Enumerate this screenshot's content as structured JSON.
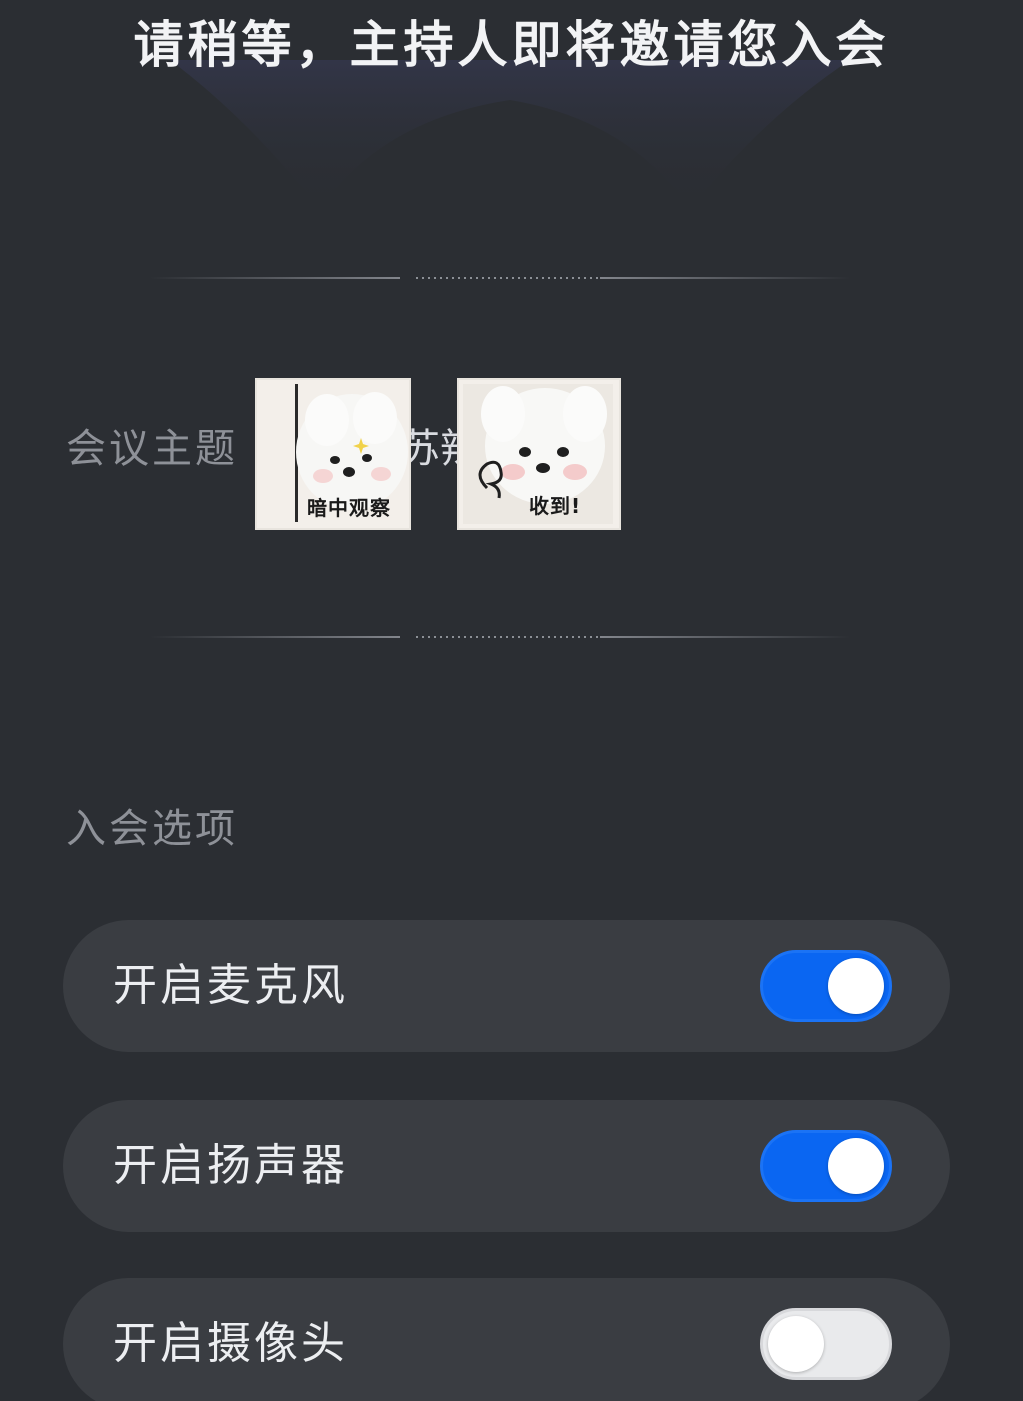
{
  "header": {
    "title": "请稍等，主持人即将邀请您入会"
  },
  "meeting": {
    "topic_label": "会议主题",
    "topic_value_partial": "苏辣"
  },
  "stickers": [
    {
      "icon": "dog-sticker-observing",
      "caption": "暗中观察"
    },
    {
      "icon": "dog-sticker-received",
      "caption": "收到!"
    }
  ],
  "options": {
    "section_label": "入会选项",
    "items": [
      {
        "label": "开启麦克风",
        "enabled": true
      },
      {
        "label": "开启扬声器",
        "enabled": true
      },
      {
        "label": "开启摄像头",
        "enabled": false
      }
    ]
  },
  "colors": {
    "background": "#2b2e33",
    "row_background": "#3a3d42",
    "toggle_on": "#0a66f2",
    "toggle_off": "#e9eaec"
  }
}
